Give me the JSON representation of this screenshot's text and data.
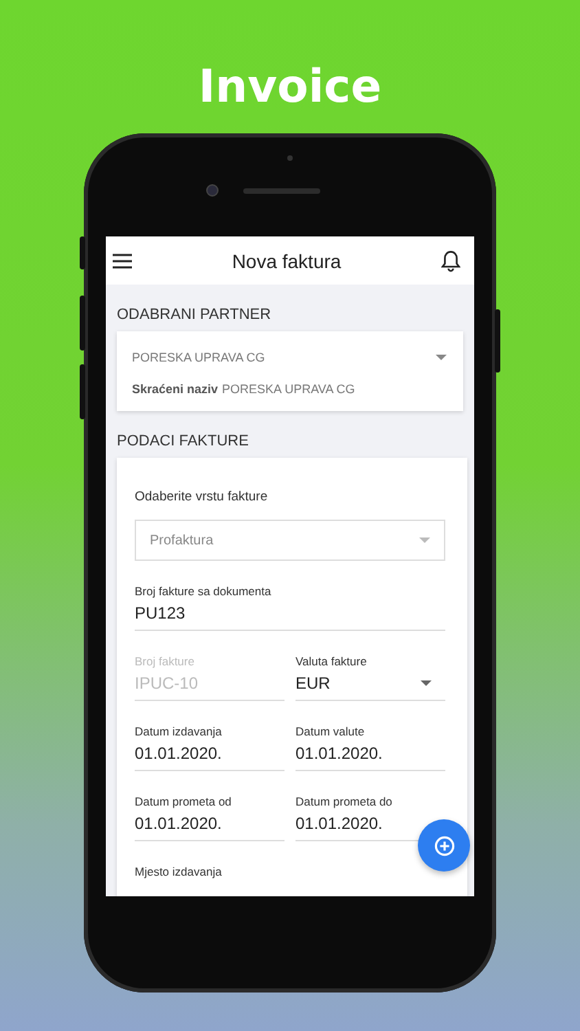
{
  "headline": "Invoice",
  "app_bar": {
    "title": "Nova faktura"
  },
  "partner_section": {
    "heading": "ODABRANI PARTNER",
    "partner": "PORESKA UPRAVA CG",
    "short_name_label": "Skraćeni naziv",
    "short_name": "PORESKA UPRAVA CG"
  },
  "invoice_section": {
    "heading": "PODACI FAKTURE",
    "type_label": "Odaberite vrstu fakture",
    "type_value": "Profaktura",
    "fields": [
      [
        {
          "label": "Broj fakture sa dokumenta",
          "value": "PU123",
          "disabled": false,
          "dropdown": false
        }
      ],
      [
        {
          "label": "Broj fakture",
          "value": "IPUC-10",
          "disabled": true,
          "dropdown": false
        },
        {
          "label": "Valuta fakture",
          "value": "EUR",
          "disabled": false,
          "dropdown": true
        }
      ],
      [
        {
          "label": "Datum izdavanja",
          "value": "01.01.2020.",
          "disabled": false,
          "dropdown": false
        },
        {
          "label": "Datum valute",
          "value": "01.01.2020.",
          "disabled": false,
          "dropdown": false
        }
      ],
      [
        {
          "label": "Datum prometa od",
          "value": "01.01.2020.",
          "disabled": false,
          "dropdown": false
        },
        {
          "label": "Datum prometa do",
          "value": "01.01.2020.",
          "disabled": false,
          "dropdown": false
        }
      ],
      [
        {
          "label": "Mjesto izdavanja"
        }
      ]
    ]
  }
}
